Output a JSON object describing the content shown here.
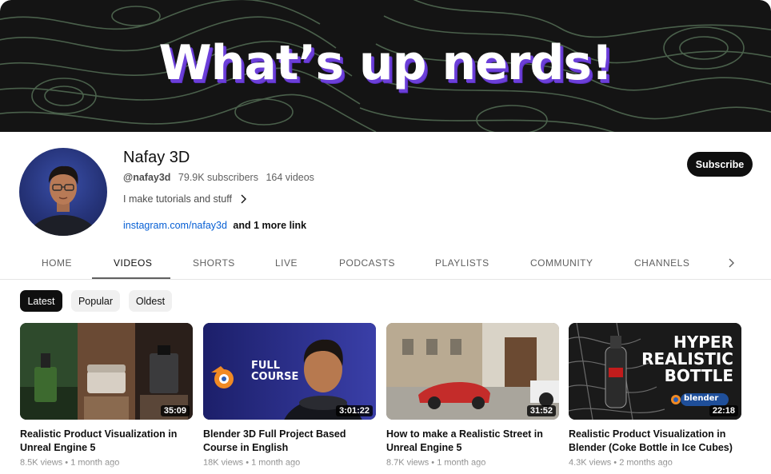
{
  "banner": {
    "title": "What’s up nerds!"
  },
  "channel": {
    "name": "Nafay 3D",
    "handle": "@nafay3d",
    "subscribers": "79.9K subscribers",
    "videos": "164 videos",
    "description": "I make tutorials and stuff",
    "link": "instagram.com/nafay3d",
    "more_links": "and 1 more link",
    "subscribe_label": "Subscribe"
  },
  "tabs": [
    {
      "label": "HOME",
      "active": false
    },
    {
      "label": "VIDEOS",
      "active": true
    },
    {
      "label": "SHORTS",
      "active": false
    },
    {
      "label": "LIVE",
      "active": false
    },
    {
      "label": "PODCASTS",
      "active": false
    },
    {
      "label": "PLAYLISTS",
      "active": false
    },
    {
      "label": "COMMUNITY",
      "active": false
    },
    {
      "label": "CHANNELS",
      "active": false
    }
  ],
  "chips": [
    {
      "label": "Latest",
      "selected": true
    },
    {
      "label": "Popular",
      "selected": false
    },
    {
      "label": "Oldest",
      "selected": false
    }
  ],
  "videos": [
    {
      "title": "Realistic Product Visualization in Unreal Engine 5",
      "duration": "35:09",
      "views": "8.5K views",
      "age": "1 month ago"
    },
    {
      "title": "Blender 3D Full Project Based Course in English",
      "duration": "3:01:22",
      "views": "18K views",
      "age": "1 month ago",
      "thumb_text": [
        "FULL",
        "COURSE"
      ]
    },
    {
      "title": "How to make a Realistic Street in Unreal Engine 5",
      "duration": "31:52",
      "views": "8.7K views",
      "age": "1 month ago"
    },
    {
      "title": "Realistic Product Visualization in Blender (Coke Bottle in Ice Cubes)",
      "duration": "22:18",
      "views": "4.3K views",
      "age": "2 months ago",
      "thumb_text": [
        "HYPER",
        "REALISTIC",
        "BOTTLE"
      ],
      "thumb_logo": "blender"
    }
  ],
  "meta_separator": "•",
  "colors": {
    "banner_bg": "#141414",
    "banner_title_shadow": "#6c3fd9",
    "subscribe_bg": "#0f0f0f",
    "link": "#065fd4",
    "chip_selected": "#0f0f0f",
    "chip_plain": "#f0f0f0"
  }
}
